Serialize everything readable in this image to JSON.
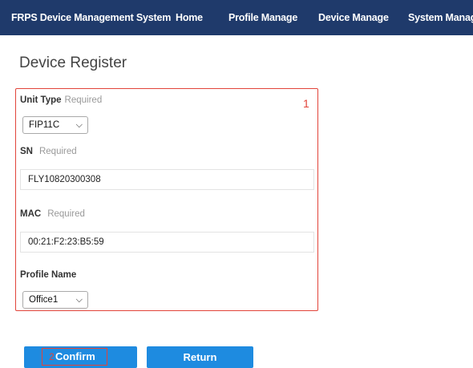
{
  "navbar": {
    "brand": "FRPS Device Management System",
    "items": [
      "Home",
      "Profile Manage",
      "Device Manage",
      "System Manage"
    ]
  },
  "page": {
    "title": "Device Register"
  },
  "annotations": {
    "form_marker": "1",
    "confirm_marker": "2"
  },
  "form": {
    "unit_type": {
      "label": "Unit Type",
      "hint": "Required",
      "value": "FIP11C"
    },
    "sn": {
      "label": "SN",
      "hint": "Required",
      "value": "FLY10820300308"
    },
    "mac": {
      "label": "MAC",
      "hint": "Required",
      "value": "00:21:F2:23:B5:59"
    },
    "profile_name": {
      "label": "Profile Name",
      "value": "Office1"
    }
  },
  "buttons": {
    "confirm": "Confirm",
    "return": "Return"
  },
  "colors": {
    "navbar": "#1f3a6b",
    "button": "#1e8be0",
    "highlight": "#e2443a"
  }
}
